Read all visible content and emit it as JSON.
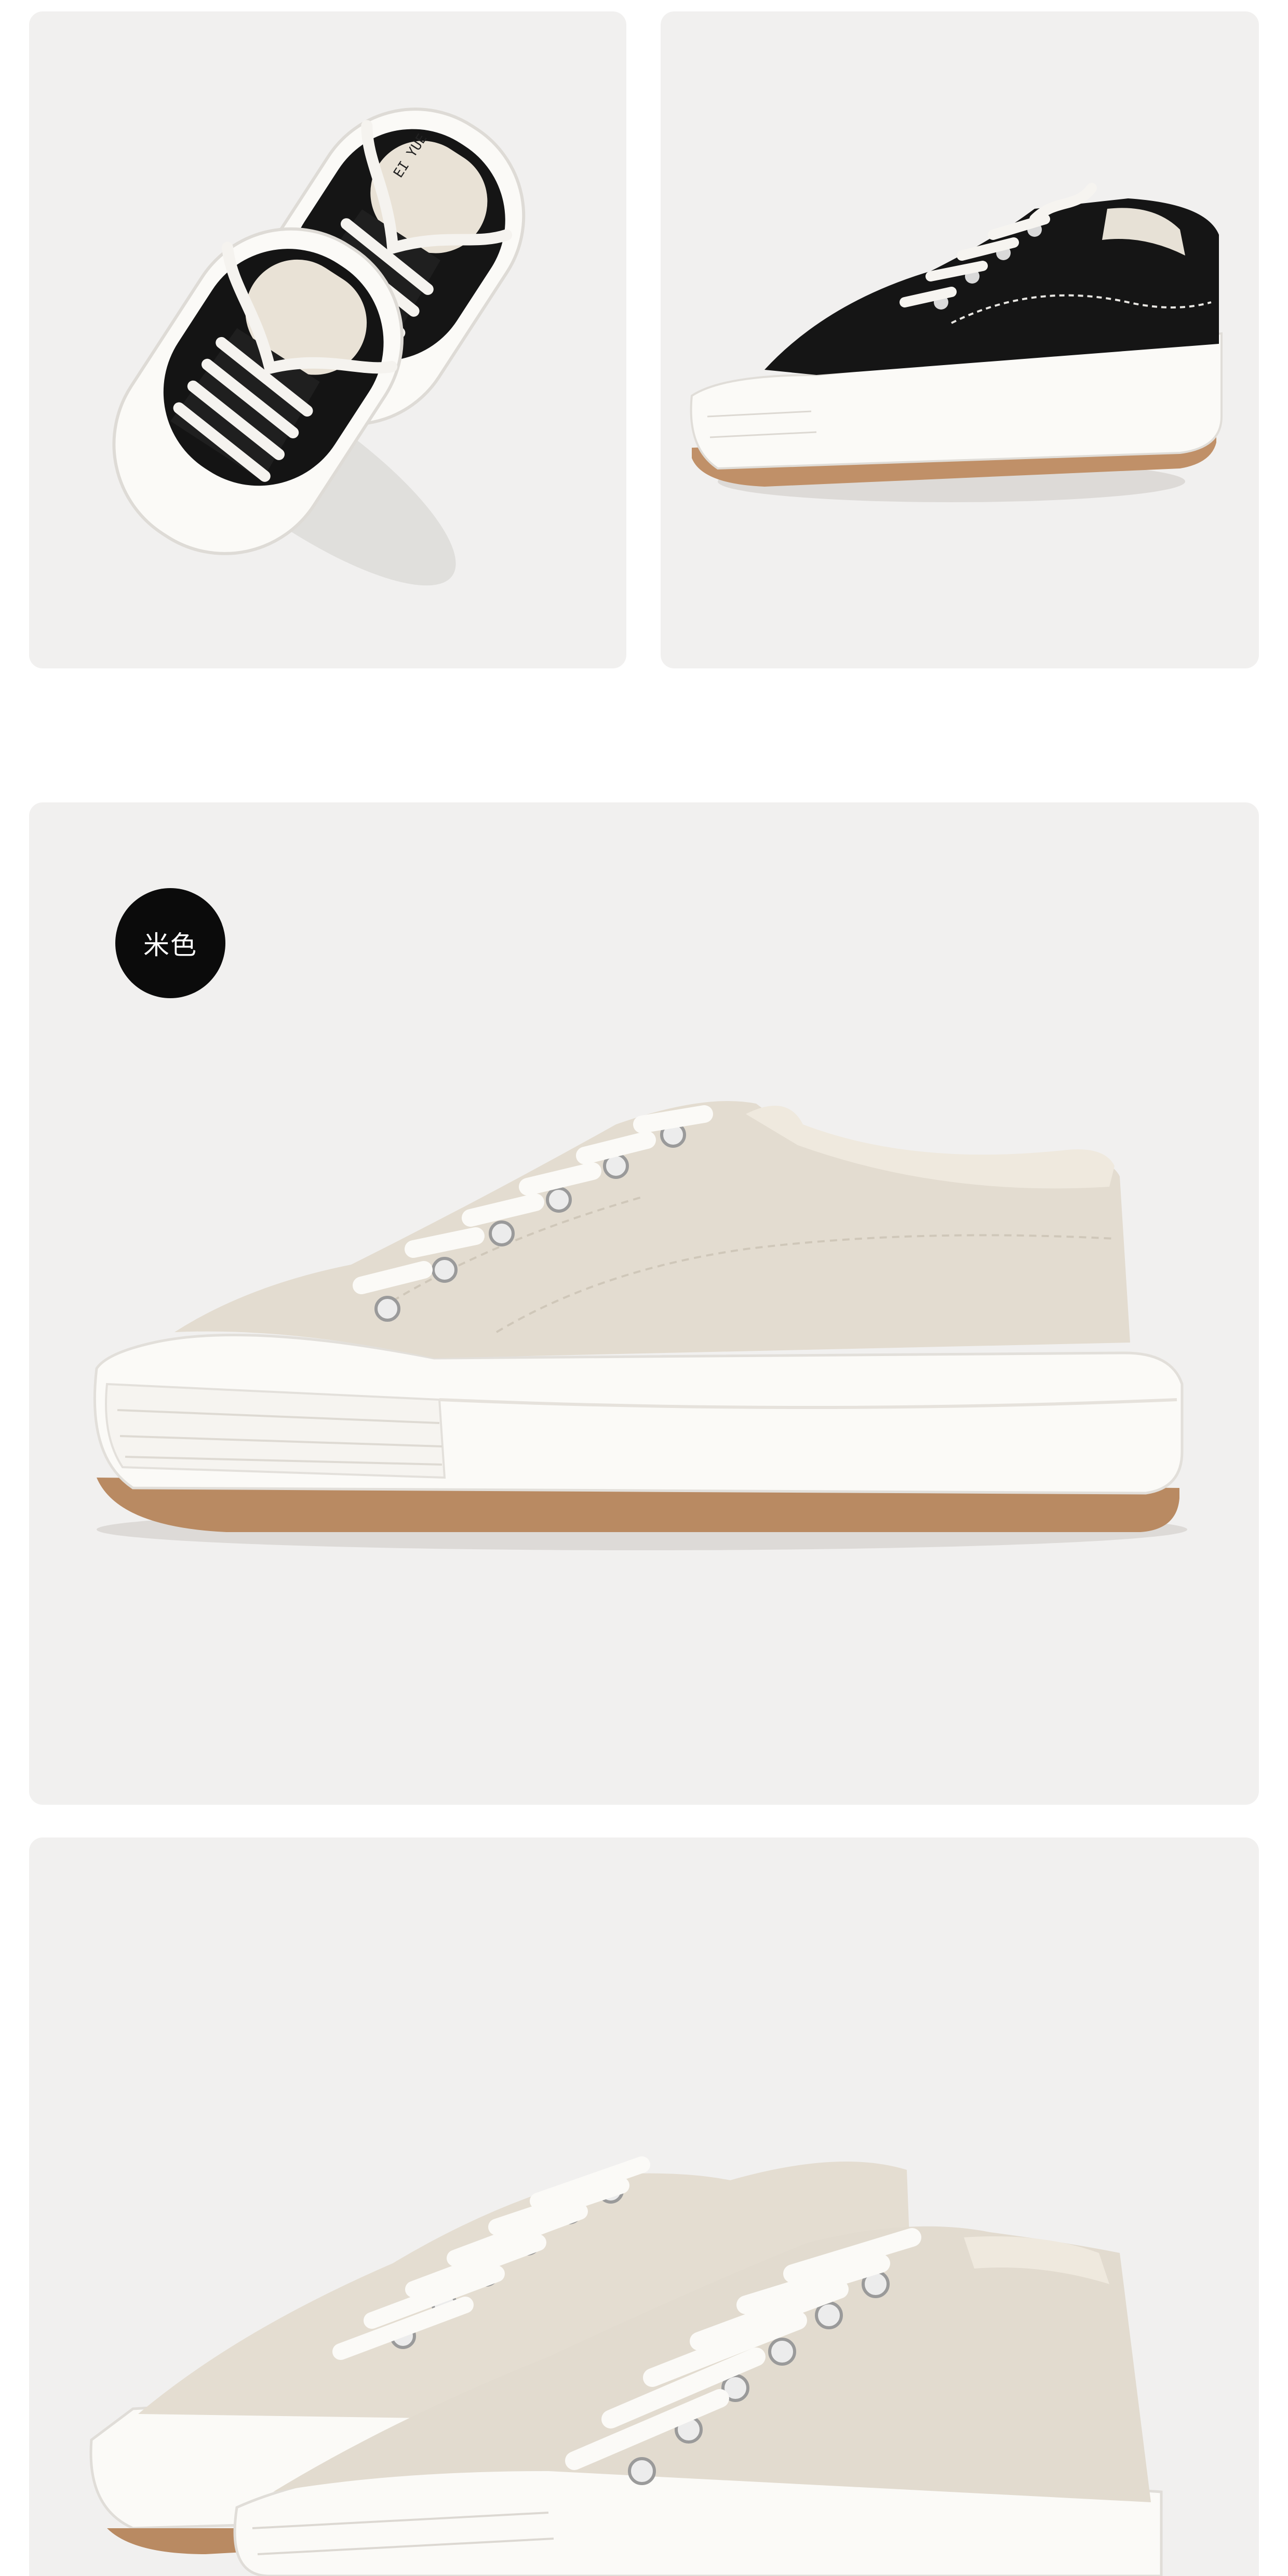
{
  "badge": {
    "label": "米色"
  },
  "brand_print": "EI YUE",
  "colors": {
    "page_background": "#ffffff",
    "panel_background": "#f1f0ef",
    "badge_background": "#0b0b0b",
    "badge_text": "#ffffff",
    "shoe_black": "#141414",
    "shoe_beige": "#e3dcd0",
    "sole_white": "#fbfaf7",
    "sole_gum": "#b98a62"
  }
}
